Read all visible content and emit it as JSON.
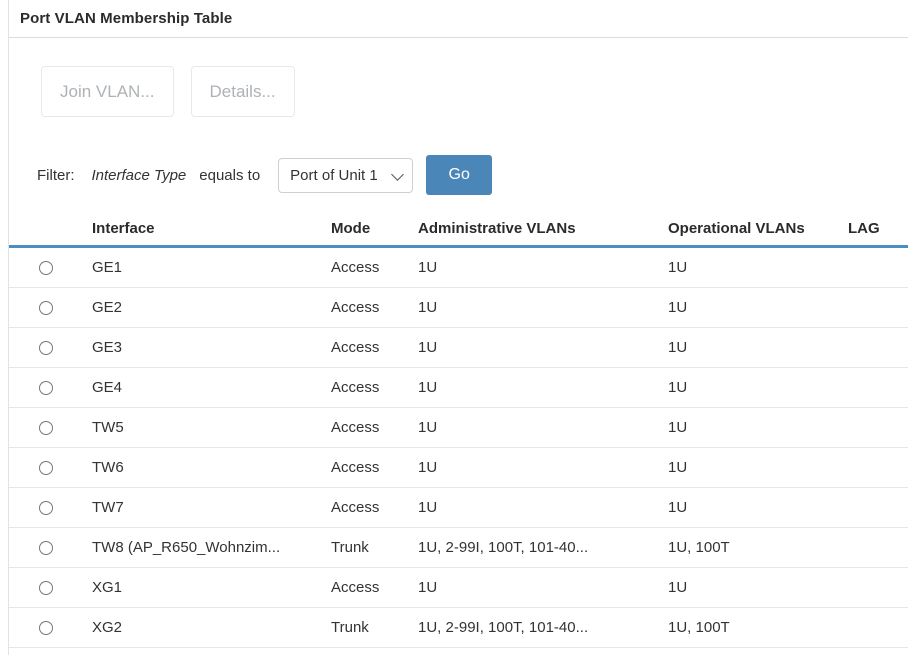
{
  "window": {
    "title": "Port VLAN Membership Table"
  },
  "actions": {
    "join_vlan_label": "Join VLAN...",
    "details_label": "Details..."
  },
  "filter": {
    "label": "Filter:",
    "field": "Interface Type",
    "operator": "equals to",
    "selected_value": "Port of Unit 1",
    "dropdown_icon": "chevron-down-icon",
    "go_label": "Go"
  },
  "table": {
    "columns": [
      "Interface",
      "Mode",
      "Administrative VLANs",
      "Operational VLANs",
      "LAG"
    ],
    "rows": [
      {
        "interface": "GE1",
        "mode": "Access",
        "admin_vlans": "1U",
        "oper_vlans": "1U",
        "lag": ""
      },
      {
        "interface": "GE2",
        "mode": "Access",
        "admin_vlans": "1U",
        "oper_vlans": "1U",
        "lag": ""
      },
      {
        "interface": "GE3",
        "mode": "Access",
        "admin_vlans": "1U",
        "oper_vlans": "1U",
        "lag": ""
      },
      {
        "interface": "GE4",
        "mode": "Access",
        "admin_vlans": "1U",
        "oper_vlans": "1U",
        "lag": ""
      },
      {
        "interface": "TW5",
        "mode": "Access",
        "admin_vlans": "1U",
        "oper_vlans": "1U",
        "lag": ""
      },
      {
        "interface": "TW6",
        "mode": "Access",
        "admin_vlans": "1U",
        "oper_vlans": "1U",
        "lag": ""
      },
      {
        "interface": "TW7",
        "mode": "Access",
        "admin_vlans": "1U",
        "oper_vlans": "1U",
        "lag": ""
      },
      {
        "interface": "TW8 (AP_R650_Wohnzim...",
        "mode": "Trunk",
        "admin_vlans": "1U, 2-99I, 100T, 101-40...",
        "oper_vlans": "1U, 100T",
        "lag": ""
      },
      {
        "interface": "XG1",
        "mode": "Access",
        "admin_vlans": "1U",
        "oper_vlans": "1U",
        "lag": ""
      },
      {
        "interface": "XG2",
        "mode": "Trunk",
        "admin_vlans": "1U, 2-99I, 100T, 101-40...",
        "oper_vlans": "1U, 100T",
        "lag": ""
      }
    ]
  },
  "colors": {
    "accent_blue": "#4a8ec2",
    "go_button": "#4a86b8",
    "text": "#333333",
    "row_divider": "#e6e6e6"
  }
}
